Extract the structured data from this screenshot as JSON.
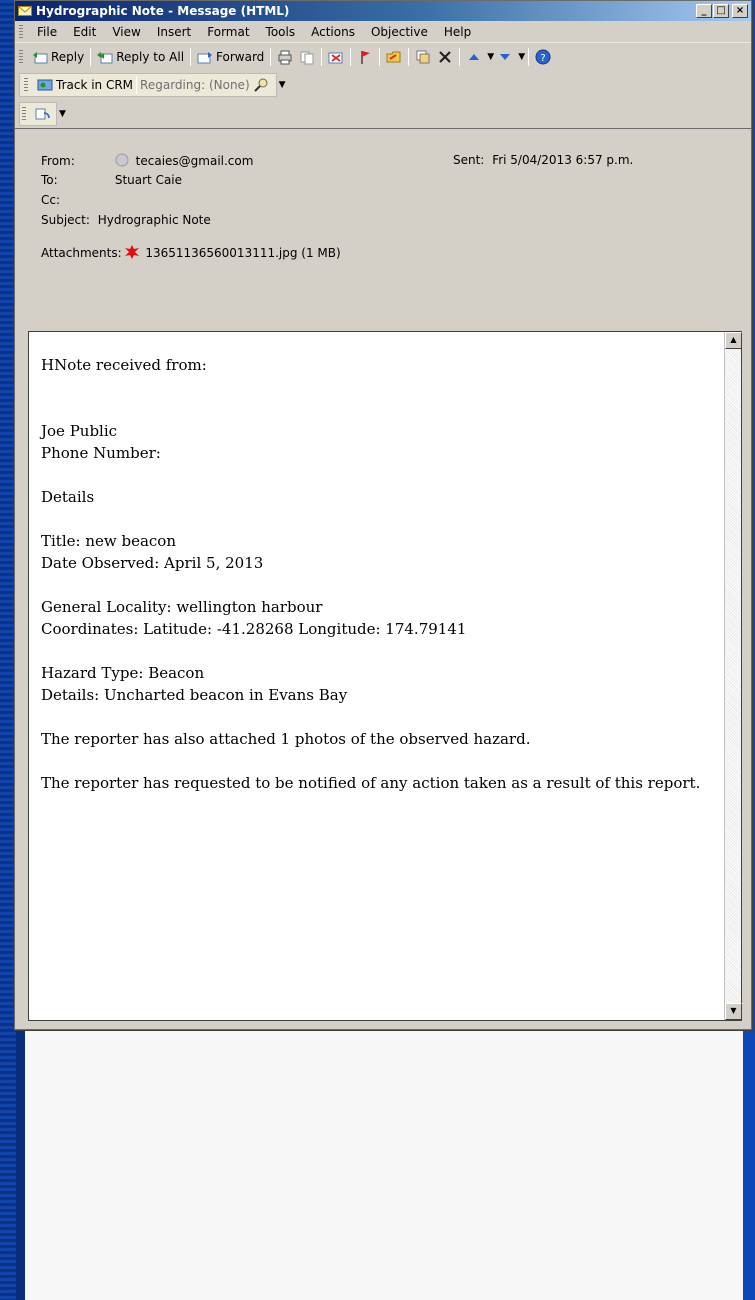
{
  "window": {
    "title": "Hydrographic Note - Message (HTML)",
    "minimize": "_",
    "maximize": "□",
    "close": "×"
  },
  "menu": [
    "File",
    "Edit",
    "View",
    "Insert",
    "Format",
    "Tools",
    "Actions",
    "Objective",
    "Help"
  ],
  "toolbar": {
    "reply": "Reply",
    "reply_all": "Reply to All",
    "forward": "Forward"
  },
  "crm": {
    "track": "Track in CRM",
    "regarding": "Regarding: (None)"
  },
  "header": {
    "from_label": "From:",
    "from_value": "tecaies@gmail.com",
    "to_label": "To:",
    "to_value": "Stuart Caie",
    "cc_label": "Cc:",
    "cc_value": "",
    "subject_label": "Subject:",
    "subject_value": "Hydrographic Note",
    "sent_label": "Sent:",
    "sent_value": "Fri 5/04/2013 6:57 p.m.",
    "attachments_label": "Attachments:",
    "attachment_name": "13651136560013111.jpg (1 MB)"
  },
  "message": {
    "line1": "HNote received from:",
    "name": "Joe Public",
    "phone": "Phone Number:",
    "details_heading": "Details",
    "title": "Title: new beacon",
    "date_observed": "Date Observed: April 5, 2013",
    "locality": "General Locality: wellington harbour",
    "coordinates": "Coordinates: Latitude: -41.28268 Longitude: 174.79141",
    "hazard_type": "Hazard Type: Beacon",
    "details": "Details: Uncharted beacon in Evans Bay",
    "photos": "The reporter has also attached 1 photos of the observed hazard.",
    "notify": "The reporter has requested to be notified of any action taken as a result of this report."
  },
  "colors": {
    "titlebar_start": "#0a246a",
    "window_face": "#d4d0c8",
    "background": "#0d3fa8"
  }
}
